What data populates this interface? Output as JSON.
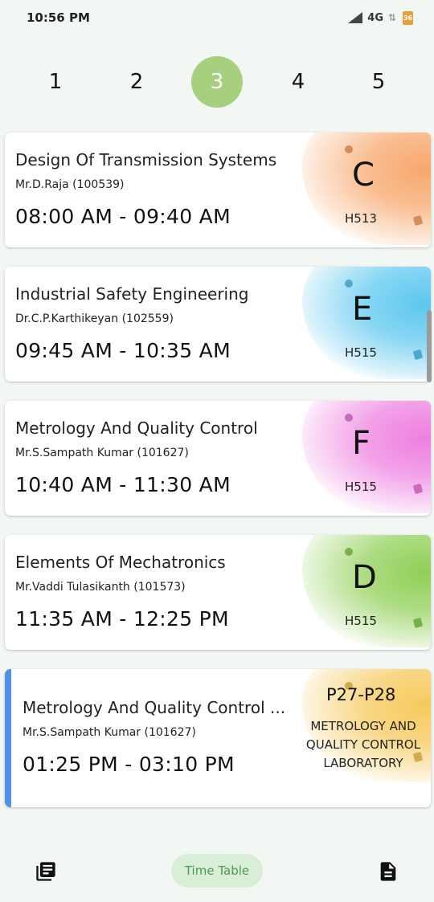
{
  "status_bar": {
    "time": "10:56 PM",
    "network": "4G",
    "battery": "36"
  },
  "day_tabs": [
    "1",
    "2",
    "3",
    "4",
    "5"
  ],
  "active_day": "3",
  "classes": [
    {
      "subject": "Design Of Transmission Systems",
      "teacher": "Mr.D.Raja (100539)",
      "time": "08:00 AM - 09:40 AM",
      "section": "C",
      "room": "H513",
      "color": "#f7a76b"
    },
    {
      "subject": "Industrial Safety Engineering",
      "teacher": "Dr.C.P.Karthikeyan (102559)",
      "time": "09:45 AM - 10:35 AM",
      "section": "E",
      "room": "H515",
      "color": "#5cc7ef"
    },
    {
      "subject": "Metrology And Quality Control",
      "teacher": "Mr.S.Sampath Kumar (101627)",
      "time": "10:40 AM - 11:30 AM",
      "section": "F",
      "room": "H515",
      "color": "#ee7fe0"
    },
    {
      "subject": "Elements Of Mechatronics",
      "teacher": "Mr.Vaddi Tulasikanth (101573)",
      "time": "11:35 AM - 12:25 PM",
      "section": "D",
      "room": "H515",
      "color": "#8fcf55"
    }
  ],
  "lab_class": {
    "subject": "Metrology And Quality Control ...",
    "teacher": "Mr.S.Sampath Kumar (101627)",
    "time": "01:25 PM - 03:10 PM",
    "period": "P27-P28",
    "lab_name": "METROLOGY AND QUALITY CONTROL LABORATORY",
    "color": "#f6c95a",
    "accent": "#4f93e6"
  },
  "bottom_nav": {
    "left_icon": "library-books-icon",
    "center_label": "Time Table",
    "right_icon": "document-icon"
  }
}
